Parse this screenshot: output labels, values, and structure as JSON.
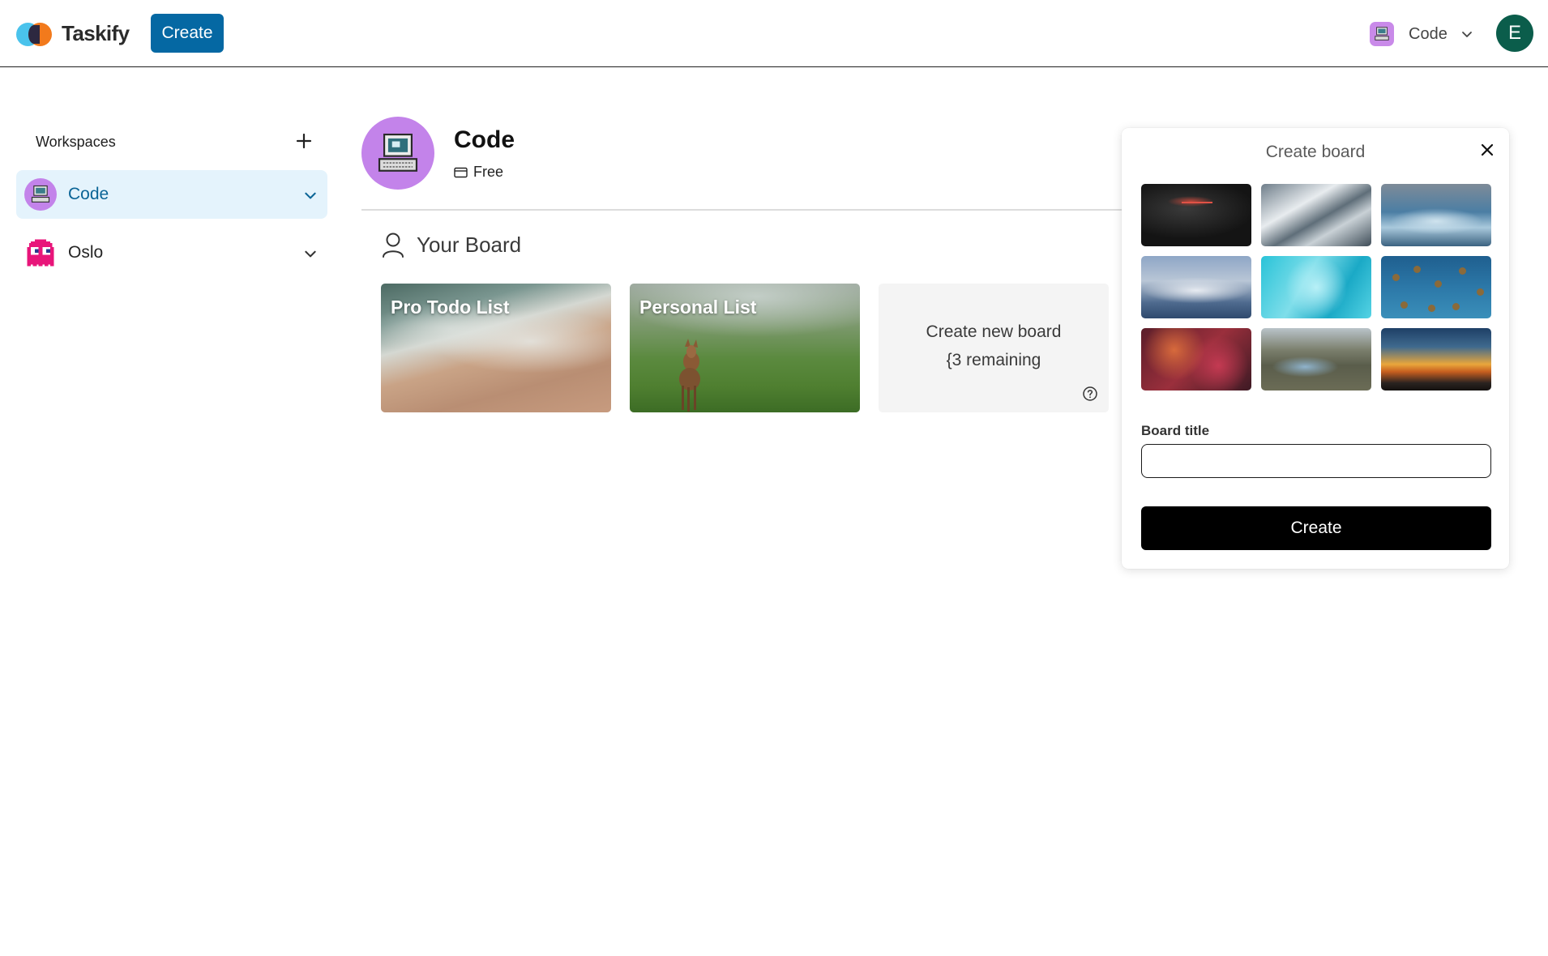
{
  "app": {
    "name": "Taskify",
    "create_label": "Create"
  },
  "topbar": {
    "workspace_name": "Code",
    "avatar_initial": "E"
  },
  "sidebar": {
    "title": "Workspaces",
    "items": [
      {
        "label": "Code",
        "icon": "computer-icon",
        "active": true
      },
      {
        "label": "Oslo",
        "icon": "ghost-icon",
        "active": false
      }
    ]
  },
  "workspace": {
    "name": "Code",
    "plan": "Free"
  },
  "boards": {
    "section_title": "Your Board",
    "items": [
      {
        "title": "Pro Todo List"
      },
      {
        "title": "Personal List"
      }
    ],
    "new_board_label": "Create new board",
    "remaining_label": "{3 remaining"
  },
  "create_board": {
    "title": "Create board",
    "field_label": "Board title",
    "field_value": "",
    "submit_label": "Create"
  },
  "colors": {
    "primary": "#0568a3",
    "active_bg": "#e4f3fc",
    "workspace_purple": "#c383ea",
    "avatar_bg": "#0b5d4b"
  }
}
